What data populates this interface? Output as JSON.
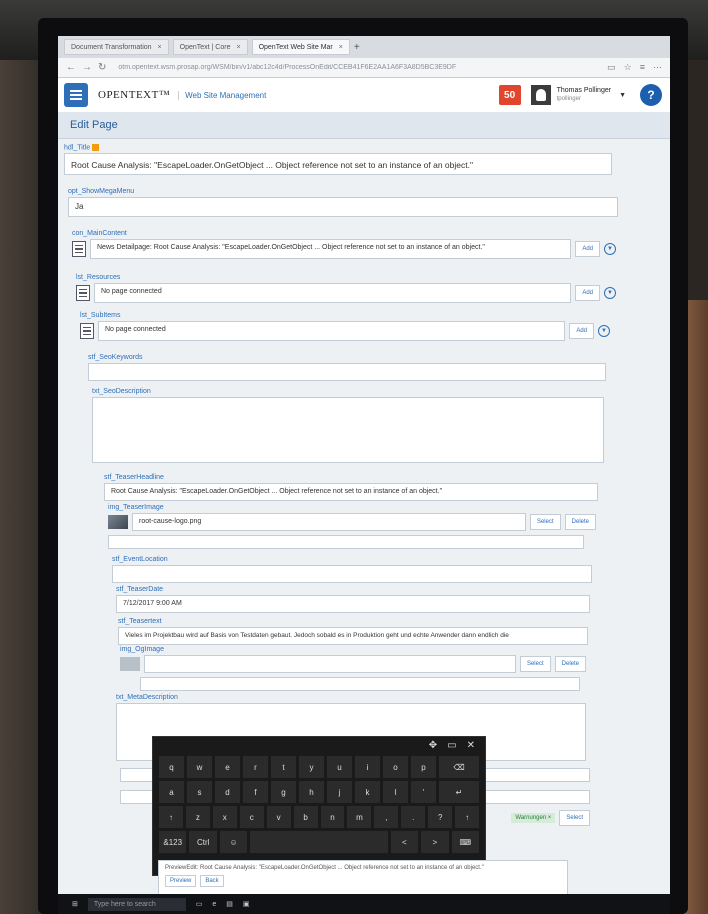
{
  "browser": {
    "tabs": [
      {
        "label": "Document Transformation"
      },
      {
        "label": "OpenText | Core"
      },
      {
        "label": "OpenText Web Site Mar",
        "active": true
      }
    ],
    "url": "otm.opentext.wsm.prosap.org/WSM/bin/v1/abc12c4d/ProcessOnEdit/CCEB41F6E2AA1A6F3A8D5BC3E9DF"
  },
  "header": {
    "brand": "OPENTEXT™",
    "app_title": "Web Site Management",
    "notifications": "50",
    "user_name": "Thomas Pollinger",
    "user_sub": "tpollinger"
  },
  "page_title": "Edit Page",
  "fields": {
    "hdl_title": {
      "label": "hdl_Title",
      "value": "Root Cause Analysis: \"EscapeLoader.OnGetObject ... Object reference not set to an instance of an object.\""
    },
    "opt_showmegamenu": {
      "label": "opt_ShowMegaMenu",
      "value": "Ja"
    },
    "con_maincontent": {
      "label": "con_MainContent",
      "value": "News Detailpage: Root Cause Analysis: \"EscapeLoader.OnGetObject ... Object reference not set to an instance of an object.\""
    },
    "lst_resources": {
      "label": "lst_Resources",
      "value": "No page connected"
    },
    "lst_subitems": {
      "label": "lst_SubItems",
      "value": "No page connected"
    },
    "stf_seokeywords": {
      "label": "stf_SeoKeywords",
      "value": ""
    },
    "txt_seodescription": {
      "label": "txt_SeoDescription",
      "value": ""
    },
    "stf_teaserheadline": {
      "label": "stf_TeaserHeadline",
      "value": "Root Cause Analysis: \"EscapeLoader.OnGetObject ... Object reference not set to an instance of an object.\""
    },
    "img_teaserimage": {
      "label": "img_TeaserImage",
      "value": "root-cause-logo.png"
    },
    "stf_eventlocation": {
      "label": "stf_EventLocation",
      "value": ""
    },
    "stf_teaserdate": {
      "label": "stf_TeaserDate",
      "value": "7/12/2017 9:00 AM"
    },
    "stf_teasertext": {
      "label": "stf_Teasertext",
      "value": "Vieles im Projektbau wird auf Basis von Testdaten gebaut. Jedoch sobald es in Produktion geht und echte Anwender dann endlich die"
    },
    "img_ogimage": {
      "label": "img_OgImage",
      "value": ""
    },
    "txt_metadescription": {
      "label": "txt_MetaDescription",
      "value": ""
    }
  },
  "buttons": {
    "add": "Add",
    "select": "Select",
    "delete": "Delete"
  },
  "tag": "Warnungen ×",
  "keyboard": {
    "rows": [
      [
        "q",
        "w",
        "e",
        "r",
        "t",
        "y",
        "u",
        "i",
        "o",
        "p",
        "⌫"
      ],
      [
        "a",
        "s",
        "d",
        "f",
        "g",
        "h",
        "j",
        "k",
        "l",
        "'",
        "↵"
      ],
      [
        "↑",
        "z",
        "x",
        "c",
        "v",
        "b",
        "n",
        "m",
        ",",
        ".",
        "?",
        "↑"
      ],
      [
        "&123",
        "Ctrl",
        "☺",
        " ",
        "<",
        ">",
        "⌨"
      ]
    ]
  },
  "footer": {
    "text": "PreviewEdit: Root Cause Analysis: \"EscapeLoader.OnGetObject ... Object reference not set to an instance of an object.\"",
    "btn1": "Preview",
    "btn2": "Back"
  },
  "taskbar": {
    "search": "Type here to search"
  }
}
